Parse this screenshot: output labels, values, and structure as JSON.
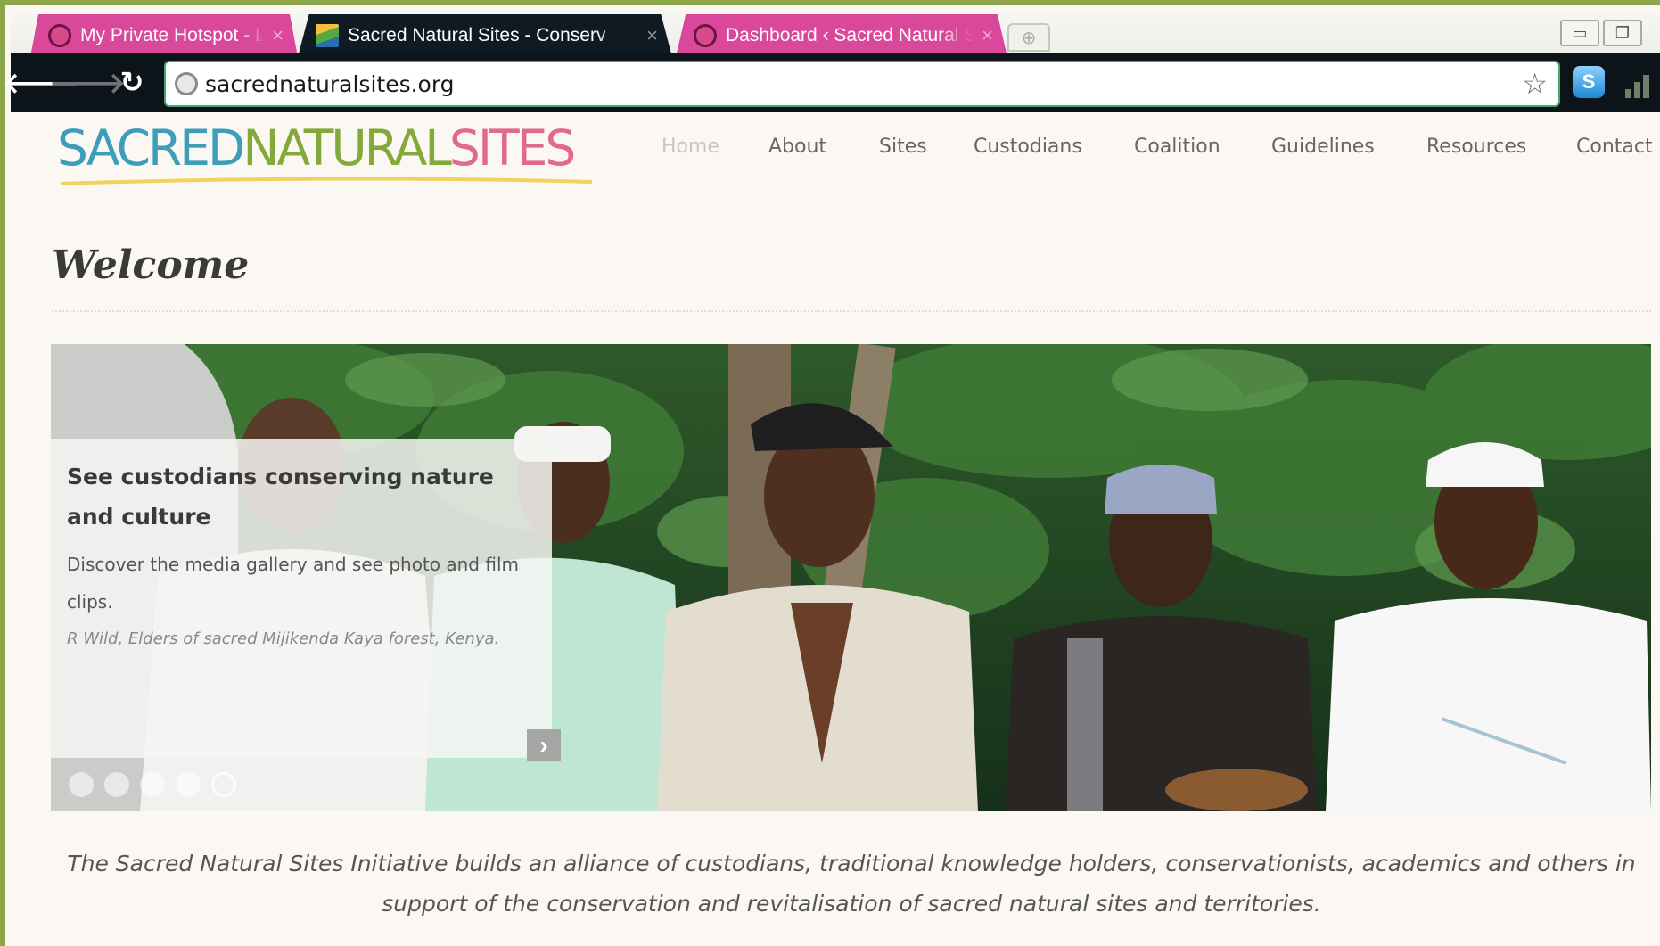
{
  "browser": {
    "tabs": [
      {
        "title": "My Private Hotspot - Landen /",
        "close": "×"
      },
      {
        "title": "Sacred Natural Sites - Conserv",
        "close": "×"
      },
      {
        "title": "Dashboard ‹ Sacred Natural Si",
        "close": "×"
      }
    ],
    "url": "sacrednaturalsites.org",
    "back_glyph": "🡐",
    "forward_glyph": "🡒",
    "reload_glyph": "↻",
    "star_glyph": "☆",
    "colors": {
      "tab_pink": "#d9489a",
      "tab_active": "#0f1a22",
      "toolbar": "#0d1419",
      "frame": "#8da64a"
    }
  },
  "site": {
    "logo": {
      "part1": "SACRED",
      "part2": "NATURAL",
      "part3": "SITES"
    },
    "nav": [
      "Home",
      "About",
      "Sites",
      "Custodians",
      "Coalition",
      "Guidelines",
      "Resources",
      "Contact"
    ],
    "page_title": "Welcome",
    "slider": {
      "caption_title": "See custodians conserving nature and culture",
      "caption_text": "Discover the media gallery and see photo and film clips.",
      "caption_credit": "R Wild, Elders of sacred Mijikenda Kaya forest, Kenya.",
      "next_glyph": "›",
      "dots_count": 5,
      "active_dot": 4
    },
    "intro": "The Sacred Natural Sites Initiative builds an alliance of custodians, traditional knowledge holders, conservationists, academics and others in support of the conservation and revitalisation of sacred natural sites and territories.",
    "colors": {
      "logo_blue": "#3e9db8",
      "logo_green": "#83a93b",
      "logo_pink": "#e06a8e",
      "page_bg": "#fbf8f3"
    }
  }
}
